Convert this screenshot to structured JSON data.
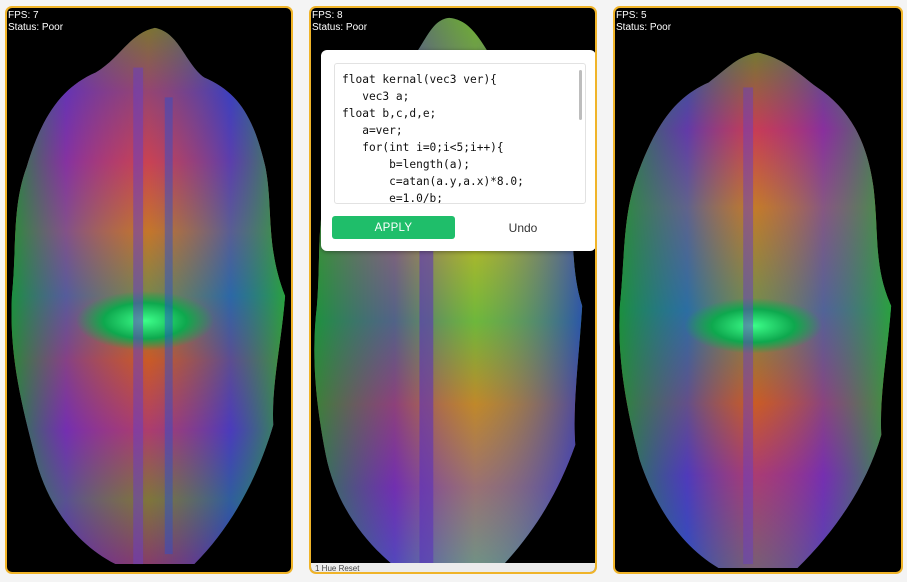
{
  "panels": [
    {
      "fps": "FPS: 7",
      "status": "Status: Poor"
    },
    {
      "fps": "FPS: 8",
      "status": "Status: Poor"
    },
    {
      "fps": "FPS: 5",
      "status": "Status: Poor"
    }
  ],
  "editor": {
    "code_lines": [
      "float kernal(vec3 ver){",
      "   vec3 a;",
      "float b,c,d,e;",
      "   a=ver;",
      "   for(int i=0;i<5;i++){",
      "       b=length(a);",
      "       c=atan(a.y,a.x)*8.0;",
      "       e=1.0/b;"
    ],
    "apply_label": "APPLY",
    "undo_label": "Undo"
  },
  "bottom_strip_text": "1 Hue                 Reset",
  "colors": {
    "panel_border": "#f0b429",
    "apply_green": "#1fbe6a",
    "canvas_bg": "#000000"
  }
}
